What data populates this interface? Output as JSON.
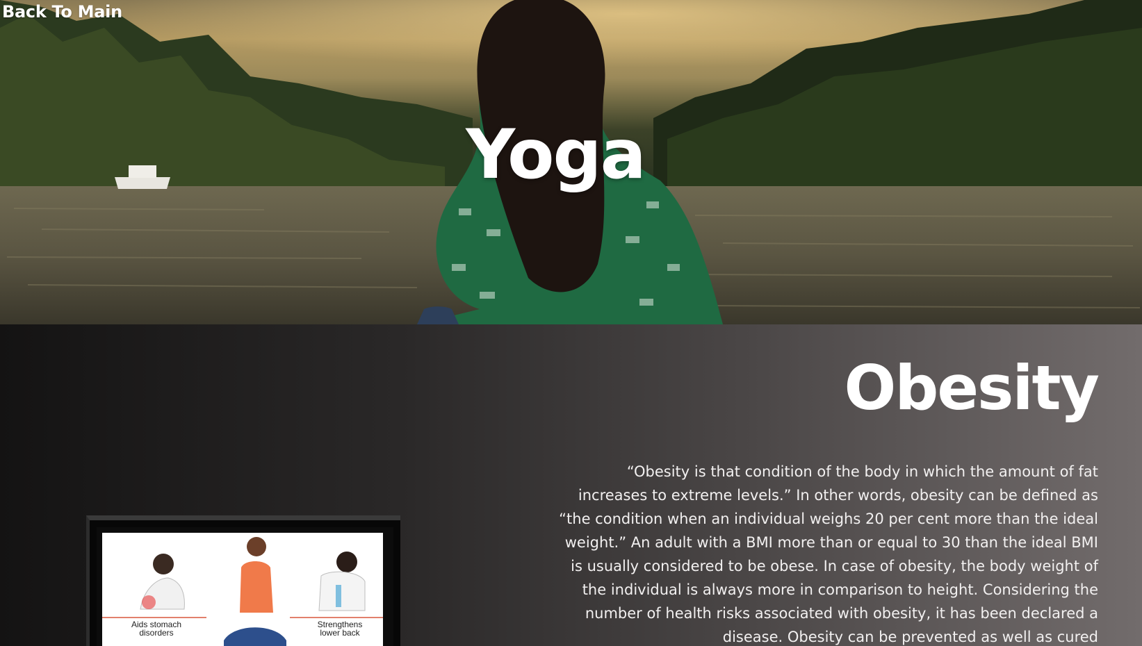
{
  "nav": {
    "back_label": "Back To Main"
  },
  "hero": {
    "title": "Yoga"
  },
  "section": {
    "title": "Obesity",
    "paragraph": "“Obesity is that condition of the body in which the amount of fat increases to extreme levels.” In other words, obesity can be defined as “the condition when an individual weighs 20 per cent more than the ideal weight.” An adult with a BMI more than or equal to 30 than the ideal BMI is usually considered to be obese. In case of obesity, the body weight of the individual is always more in comparison to height. Considering the number of health risks associated with obesity, it has been declared a disease. Obesity can be prevented as well as cured"
  },
  "figure": {
    "left_label": "Aids stomach disorders",
    "right_label": "Strengthens lower back"
  },
  "colors": {
    "hero_sky": "#b49a62",
    "forest": "#2a3320",
    "water": "#5e5a48",
    "shirt": "#2f6a46",
    "content_dark": "#141313",
    "content_light": "#726c6c"
  }
}
